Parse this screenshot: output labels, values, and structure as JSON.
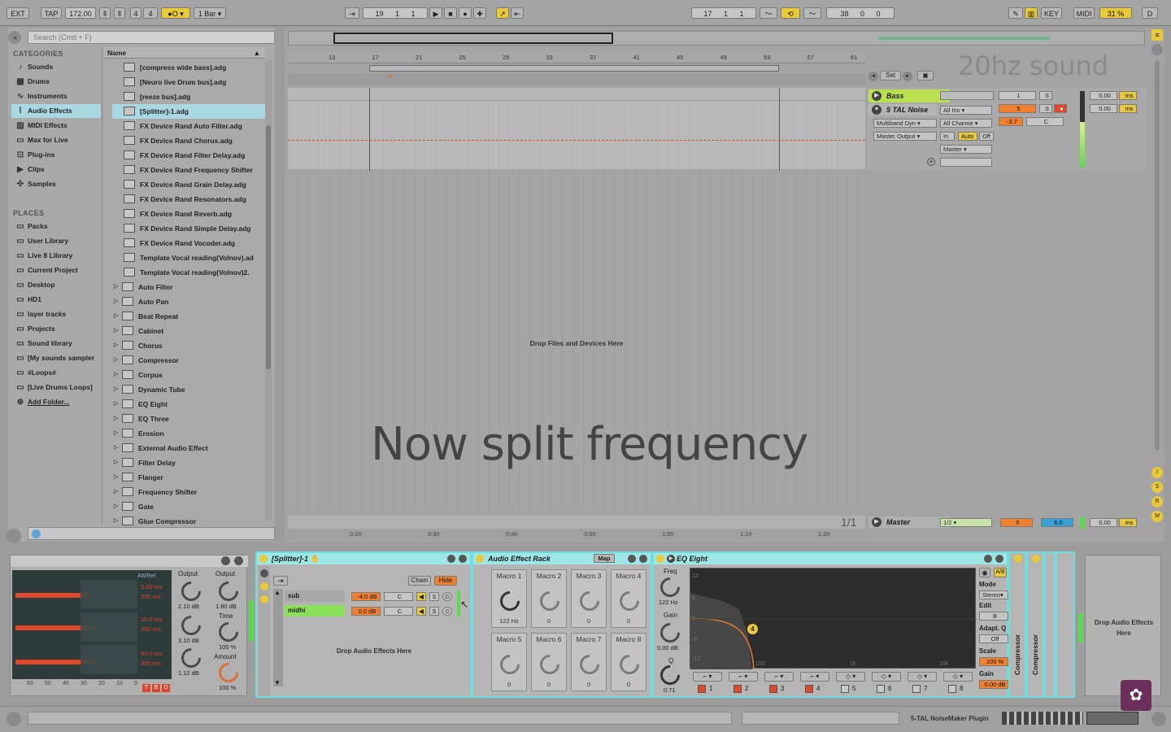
{
  "transport": {
    "ext": "EXT",
    "tap": "TAP",
    "tempo": "172.00",
    "sig_num": "4",
    "sig_den": "4",
    "quantize": "1 Bar",
    "position": [
      "19",
      "1",
      "1"
    ],
    "loop_start": [
      "17",
      "1",
      "1"
    ],
    "loop_length": [
      "38",
      "0",
      "0"
    ],
    "key": "KEY",
    "midi": "MIDI",
    "cpu": "31 %",
    "d": "D"
  },
  "browser": {
    "search_placeholder": "Search (Cmd + F)",
    "categories_header": "CATEGORIES",
    "categories": [
      {
        "label": "Sounds",
        "icon": "music-note-icon"
      },
      {
        "label": "Drums",
        "icon": "drum-grid-icon"
      },
      {
        "label": "Instruments",
        "icon": "instrument-icon"
      },
      {
        "label": "Audio Effects",
        "icon": "audio-effects-icon"
      },
      {
        "label": "MIDI Effects",
        "icon": "midi-effects-icon"
      },
      {
        "label": "Max for Live",
        "icon": "max-for-live-icon"
      },
      {
        "label": "Plug-ins",
        "icon": "plugin-icon"
      },
      {
        "label": "Clips",
        "icon": "clip-icon"
      },
      {
        "label": "Samples",
        "icon": "sample-icon"
      }
    ],
    "places_header": "PLACES",
    "places": [
      "Packs",
      "User Library",
      "Live 8 Library",
      "Current Project",
      "Desktop",
      "HD1",
      "layer tracks",
      "Projects",
      "Sound library",
      "[My sounds sampler",
      "#Loops#",
      "[Live Drums Loops]",
      "Add Folder..."
    ],
    "column_header": "Name",
    "files": [
      "[compress wide bass].adg",
      "[Neuro live Drum bus].adg",
      "[reeze bus].adg",
      "[Splitter]-1.adg",
      "FX Device Rand Auto Filter.adg",
      "FX Device Rand Chorus.adg",
      "FX Device Rand Filter Delay.adg",
      "FX Device Rand Frequency Shifter",
      "FX Device Rand Grain Delay.adg",
      "FX Device Rand Resonators.adg",
      "FX Device Rand Reverb.adg",
      "FX Device Rand Simple Delay.adg",
      "FX Device Rand Vocoder.adg",
      "Template Vocal reading(Volnov).ad",
      "Template Vocal reading(Volnov)2."
    ],
    "folders": [
      "Auto Filter",
      "Auto Pan",
      "Beat Repeat",
      "Cabinet",
      "Chorus",
      "Compressor",
      "Corpus",
      "Dynamic Tube",
      "EQ Eight",
      "EQ Three",
      "Erosion",
      "External Audio Effect",
      "Filter Delay",
      "Flanger",
      "Frequency Shifter",
      "Gate",
      "Glue Compressor"
    ]
  },
  "arrangement": {
    "ruler": [
      "13",
      "17",
      "21",
      "25",
      "29",
      "33",
      "37",
      "41",
      "45",
      "49",
      "53",
      "57",
      "61"
    ],
    "time_ruler": [
      "0:20",
      "0:30",
      "0:40",
      "0:50",
      "1:00",
      "1:10",
      "1:20"
    ],
    "drop_text": "Drop Files and Devices Here",
    "overlay_text": "Now split frequency",
    "page_counter": "1/1",
    "set_label": "Set"
  },
  "mixer": {
    "tracks": [
      {
        "name": "Bass",
        "number": "1",
        "solo": "S",
        "vol": "0.00",
        "unit": "ms"
      },
      {
        "name": "5 TAL Noise",
        "number": "5",
        "solo": "S",
        "vol": "0.00",
        "unit": "ms",
        "input": "All Ins",
        "device": "Multiband Dyn",
        "channel": "All Channe",
        "output": "Master Output",
        "monitor_in": "In",
        "monitor_auto": "Auto",
        "monitor_off": "Off",
        "route": "Master",
        "vol_db": "-3.7",
        "pan": "C"
      }
    ],
    "master": {
      "name": "Master",
      "routing": "1/2",
      "value1": "0",
      "value2": "6.0",
      "delay": "0.00",
      "unit": "ms"
    }
  },
  "watermark": "20hz sound",
  "devices": {
    "multiband": {
      "att_rel": "Att/Rel",
      "times": [
        "5.00 ms",
        "100 ms",
        "10.0 ms",
        "200 ms",
        "50.0 ms",
        "300 ms"
      ],
      "output_label1": "Output",
      "output_label2": "Output",
      "out_values": [
        "2.10 dB",
        "3.10 dB",
        "1.12 dB"
      ],
      "out2_value": "1.80 dB",
      "time_label": "Time",
      "time_value": "100 %",
      "amount_label": "Amount",
      "amount_value": "100 %",
      "scale": [
        "60",
        "50",
        "40",
        "30",
        "20",
        "10",
        "0"
      ],
      "tbd": [
        "T",
        "B",
        "D"
      ]
    },
    "splitter": {
      "title": "[Splitter]-1",
      "chain_btn": "Chain",
      "hide_btn": "Hide",
      "chains": [
        {
          "name": "sub",
          "vol": "-4.0 dB",
          "pan": "C",
          "solo": "S"
        },
        {
          "name": "midhi",
          "vol": "0.0 dB",
          "pan": "C",
          "solo": "S"
        }
      ],
      "drop_text": "Drop Audio Effects Here"
    },
    "rack": {
      "title": "Audio Effect Rack",
      "map_btn": "Map",
      "macros": [
        {
          "label": "Macro 1",
          "value": "122 Hz"
        },
        {
          "label": "Macro 2",
          "value": "0"
        },
        {
          "label": "Macro 3",
          "value": "0"
        },
        {
          "label": "Macro 4",
          "value": "0"
        },
        {
          "label": "Macro 5",
          "value": "0"
        },
        {
          "label": "Macro 6",
          "value": "0"
        },
        {
          "label": "Macro 7",
          "value": "0"
        },
        {
          "label": "Macro 8",
          "value": "0"
        }
      ]
    },
    "eq": {
      "title": "EQ Eight",
      "freq_label": "Freq",
      "freq_value": "122 Hz",
      "gain_label": "Gain",
      "gain_value": "0.00 dB",
      "q_label": "Q",
      "q_value": "0.71",
      "db_scale": [
        "12",
        "6",
        "0",
        "-6",
        "-12"
      ],
      "freq_scale": [
        "100",
        "1k",
        "10k"
      ],
      "band_marker": "4",
      "bands": [
        "1",
        "2",
        "3",
        "4",
        "5",
        "6",
        "7",
        "8"
      ],
      "mode_label": "Mode",
      "mode_value": "Stereo",
      "edit_label": "Edit",
      "edit_value": "B",
      "adapt_label": "Adapt. Q",
      "adapt_value": "Off",
      "scale_label": "Scale",
      "scale_value": "100 %",
      "gain2_label": "Gain",
      "gain2_value": "0.00 dB",
      "ab_label": "A/B"
    },
    "compressor1": "Compressor",
    "compressor2": "Compressor",
    "drop_right": "Drop Audio Effects Here"
  },
  "statusbar": {
    "plugin": "5-TAL NoiseMaker Plugin"
  },
  "colors": {
    "accent_cyan": "#73dcdc",
    "selection": "#a9d8e3",
    "orange": "#f0802e",
    "yellow": "#e8c93a",
    "green": "#8ae05a",
    "red_meter": "#e0462a"
  }
}
